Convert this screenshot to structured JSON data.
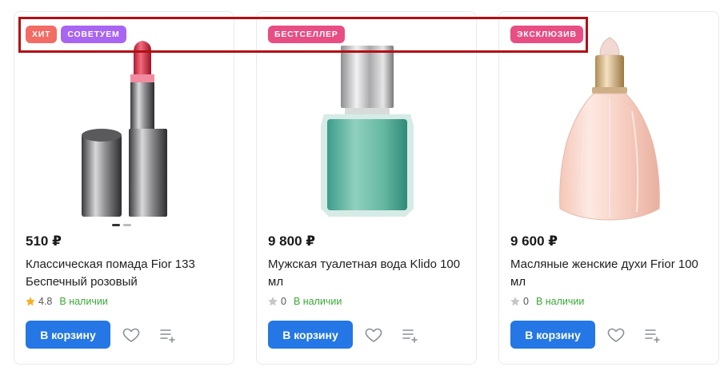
{
  "products": [
    {
      "badges": [
        {
          "label": "ХИТ",
          "color": "#f26b64"
        },
        {
          "label": "СОВЕТУЕМ",
          "color": "#a865f2"
        }
      ],
      "image_icon": "lipstick-image",
      "price": "510 ₽",
      "title": "Классическая помада Fior 133 Беспечный розовый",
      "rating": "4.8",
      "rating_star_color": "#f5b027",
      "stock": "В наличии",
      "cart_label": "В корзину"
    },
    {
      "badges": [
        {
          "label": "БЕСТСЕЛЛЕР",
          "color": "#e84d84"
        }
      ],
      "image_icon": "cologne-bottle-image",
      "price": "9 800 ₽",
      "title": "Мужская туалетная вода Klido 100 мл",
      "rating": "0",
      "rating_star_color": "#c7c7c7",
      "stock": "В наличии",
      "cart_label": "В корзину"
    },
    {
      "badges": [
        {
          "label": "ЭКСКЛЮЗИВ",
          "color": "#e84d84"
        }
      ],
      "image_icon": "perfume-bottle-image",
      "price": "9 600 ₽",
      "title": "Масляные женские духи Frior 100 мл",
      "rating": "0",
      "rating_star_color": "#c7c7c7",
      "stock": "В наличии",
      "cart_label": "В корзину"
    }
  ],
  "colors": {
    "accent": "#2477e4",
    "in_stock": "#3aa836",
    "highlight": "#b30f14"
  }
}
